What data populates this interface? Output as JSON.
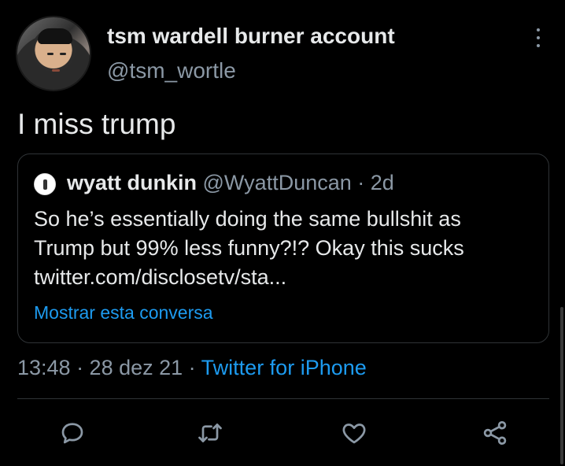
{
  "tweet": {
    "author_name": "tsm wardell burner account",
    "author_handle": "@tsm_wortle",
    "text": "I miss trump",
    "timestamp": "13:48 · 28 dez 21 · ",
    "source": "Twitter for iPhone"
  },
  "quote": {
    "author_name": "wyatt dunkin",
    "author_meta": " @WyattDuncan · 2d",
    "lines": [
      "So he’s essentially doing the same bullshit as",
      "Trump but 99% less funny?!? Okay this sucks",
      "twitter.com/disclosetv/sta..."
    ],
    "show_thread": "Mostrar esta conversa"
  },
  "actions": [
    "reply-icon",
    "retweet-icon",
    "like-icon",
    "share-icon"
  ],
  "colors": {
    "background": "#000000",
    "text": "#e7e9ea",
    "secondary": "#8b98a5",
    "link": "#1d9bf0",
    "border": "#2f3336"
  }
}
